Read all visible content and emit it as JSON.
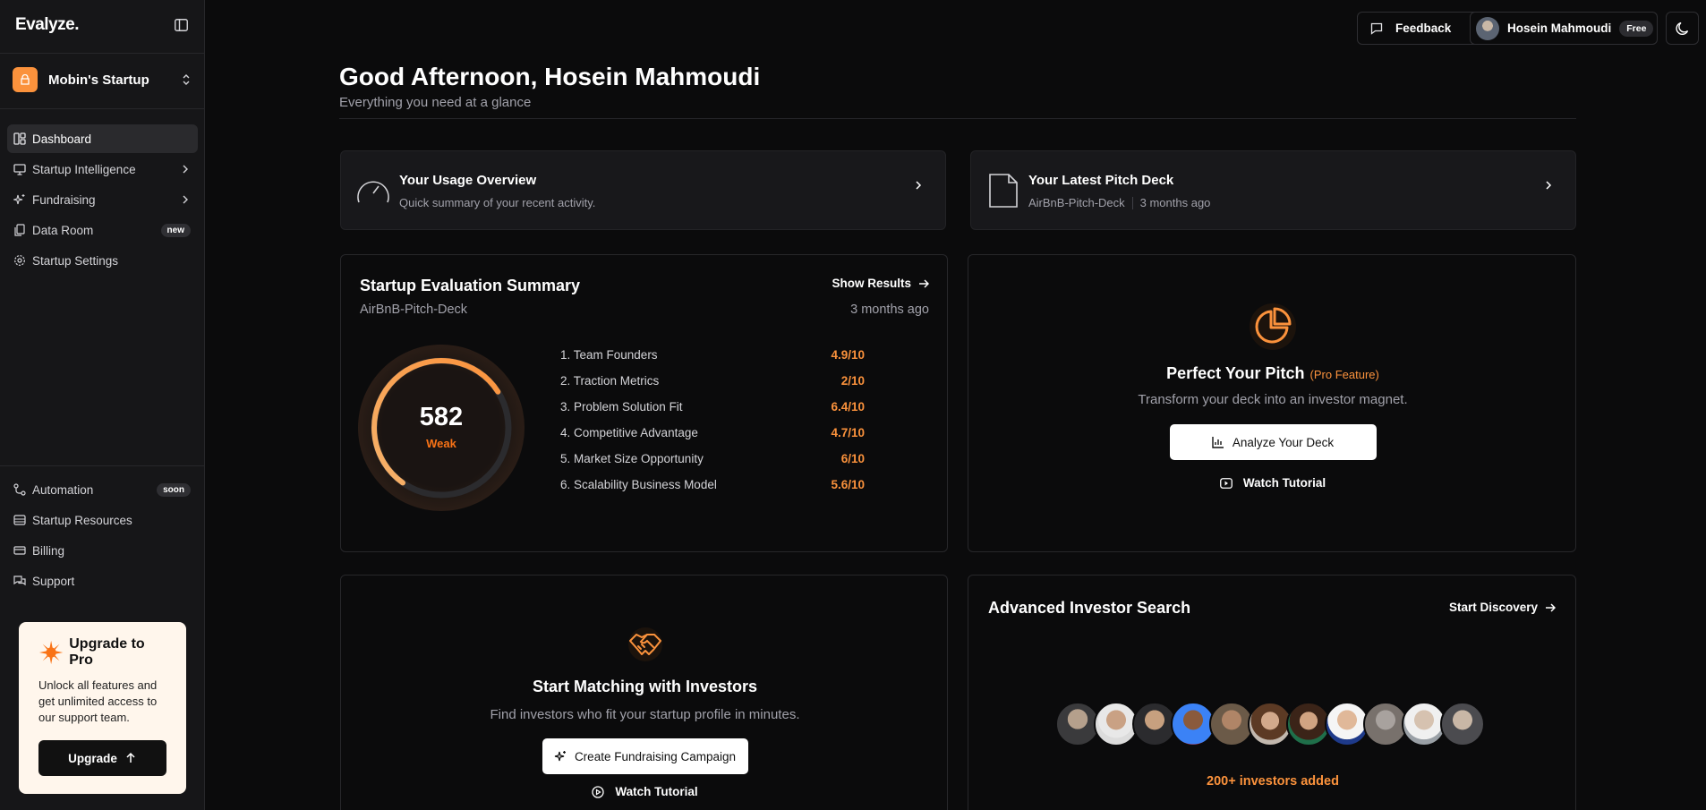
{
  "sidebar": {
    "brand": "Evalyze",
    "org_name": "Mobin's Startup",
    "nav": [
      {
        "label": "Dashboard"
      },
      {
        "label": "Startup Intelligence"
      },
      {
        "label": "Fundraising"
      },
      {
        "label": "Data Room",
        "badge": "new"
      },
      {
        "label": "Startup Settings"
      }
    ],
    "bottom_nav": [
      {
        "label": "Automation",
        "badge": "soon"
      },
      {
        "label": "Startup Resources"
      },
      {
        "label": "Billing"
      },
      {
        "label": "Support"
      }
    ],
    "upgrade": {
      "title": "Upgrade to Pro",
      "text": "Unlock all features and get unlimited access to our support team.",
      "button": "Upgrade"
    }
  },
  "header": {
    "feedback": "Feedback",
    "user_name": "Hosein Mahmoudi",
    "plan": "Free"
  },
  "main": {
    "greeting": "Good Afternoon, Hosein Mahmoudi",
    "subtitle": "Everything you need at a glance",
    "usage": {
      "title": "Your Usage Overview",
      "subtitle": "Quick summary of your recent activity."
    },
    "pitch_deck": {
      "title": "Your Latest Pitch Deck",
      "file": "AirBnB-Pitch-Deck",
      "time": "3 months ago"
    },
    "evaluation": {
      "title": "Startup Evaluation Summary",
      "action": "Show Results",
      "file": "AirBnB-Pitch-Deck",
      "time": "3 months ago",
      "score": "582",
      "score_level": 0.75,
      "rating": "Weak",
      "metrics": [
        {
          "label": "1. Team Founders",
          "value": "4.9/10"
        },
        {
          "label": "2. Traction Metrics",
          "value": "2/10"
        },
        {
          "label": "3. Problem Solution Fit",
          "value": "6.4/10"
        },
        {
          "label": "4. Competitive Advantage",
          "value": "4.7/10"
        },
        {
          "label": "5. Market Size Opportunity",
          "value": "6/10"
        },
        {
          "label": "6. Scalability Business Model",
          "value": "5.6/10"
        }
      ]
    },
    "perfect_pitch": {
      "title": "Perfect Your Pitch",
      "tag": "(Pro Feature)",
      "subtitle": "Transform your deck into an investor magnet.",
      "button": "Analyze Your Deck",
      "tutorial": "Watch Tutorial"
    },
    "matching": {
      "title": "Start Matching with Investors",
      "subtitle": "Find investors who fit your startup profile in minutes.",
      "button": "Create Fundraising Campaign",
      "tutorial": "Watch Tutorial"
    },
    "investor_search": {
      "title": "Advanced Investor Search",
      "action": "Start Discovery",
      "count_text": "200+ investors added"
    }
  },
  "colors": {
    "accent": "#fb923c",
    "background": "#0b0b0c",
    "sidebar": "#161618"
  }
}
